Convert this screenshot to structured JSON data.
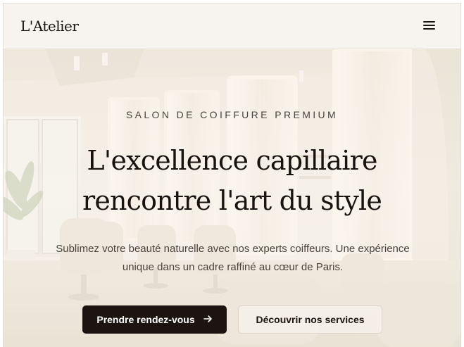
{
  "header": {
    "logo": "L'Atelier",
    "menu_icon": "hamburger-menu-icon"
  },
  "hero": {
    "eyebrow": "SALON DE COIFFURE PREMIUM",
    "headline_line1": "L'excellence capillaire",
    "headline_line2": "rencontre l'art du style",
    "subtitle_line1": "Sublimez votre beauté naturelle avec nos experts coiffeurs. Une expérience",
    "subtitle_line2": "unique dans un cadre raffiné au cœur de Paris.",
    "primary_button": "Prendre rendez-vous",
    "primary_button_icon": "arrow-right-icon",
    "secondary_button": "Découvrir nos services"
  },
  "colors": {
    "primary_button_bg": "#1c1410",
    "page_bg": "#f7f4ef",
    "text_dark": "#17130f"
  }
}
